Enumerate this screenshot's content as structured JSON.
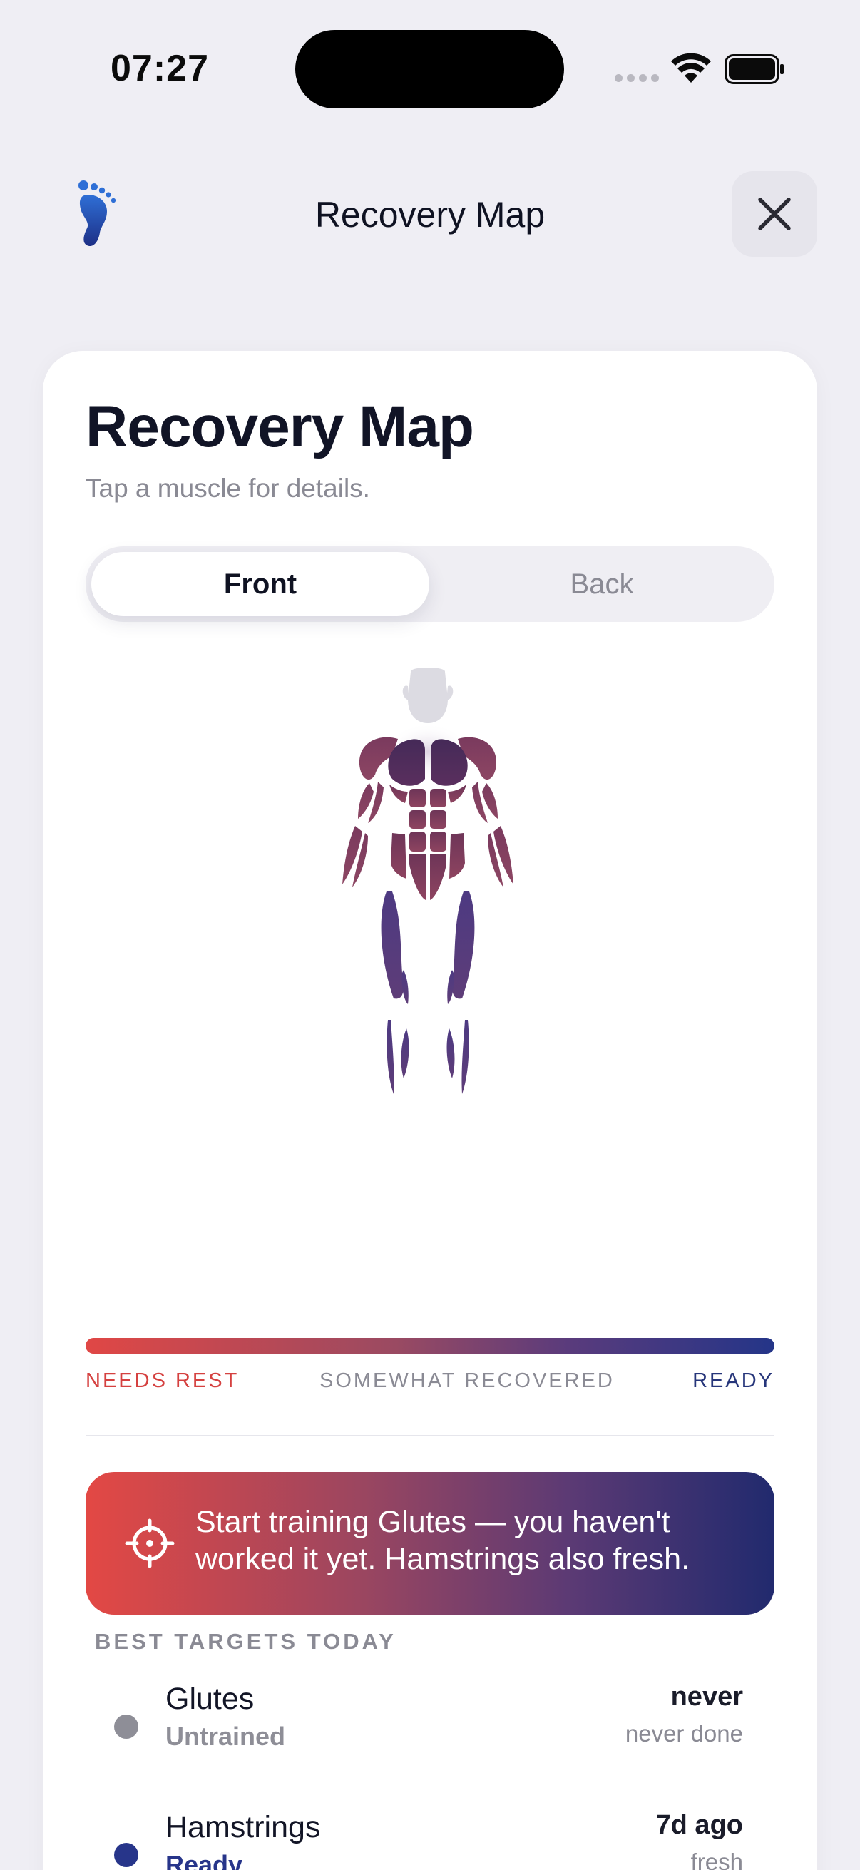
{
  "status_bar": {
    "time": "07:27"
  },
  "nav": {
    "title": "Recovery Map"
  },
  "card": {
    "title": "Recovery Map",
    "subtitle": "Tap a muscle for details.",
    "segments": {
      "front": "Front",
      "back": "Back",
      "selected": "Front"
    }
  },
  "scale": {
    "needs_rest": "NEEDS REST",
    "somewhat": "SOMEWHAT RECOVERED",
    "ready": "READY"
  },
  "banner": {
    "text": "Start training Glutes — you haven't worked it yet. Hamstrings also fresh."
  },
  "targets": {
    "heading": "BEST TARGETS TODAY",
    "items": [
      {
        "name": "Glutes",
        "status": "Untrained",
        "when": "never",
        "detail": "never done",
        "color": "#8e8e97"
      },
      {
        "name": "Hamstrings",
        "status": "Ready",
        "when": "7d ago",
        "detail": "fresh",
        "color": "#27358a"
      }
    ]
  },
  "colors": {
    "needs_rest": "#e04745",
    "ready": "#243588",
    "background": "#efeef4"
  }
}
